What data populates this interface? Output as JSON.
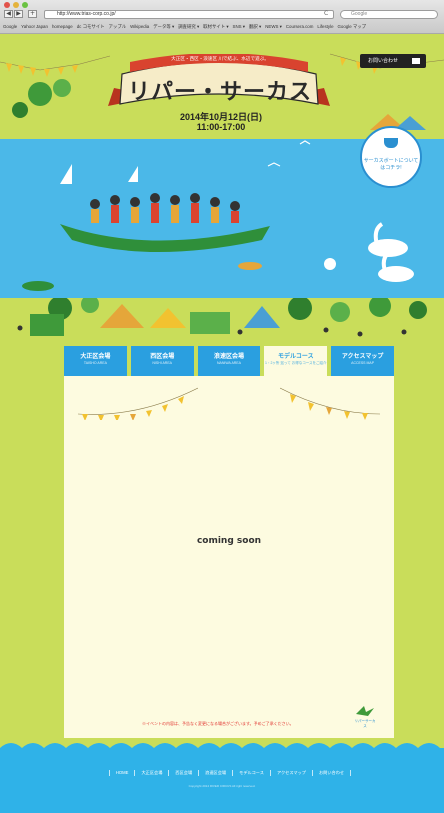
{
  "browser": {
    "url": "http://www.trias-corp.co.jp/",
    "search_placeholder": "Google",
    "bookmarks": [
      "Google",
      "Yahoo! Japan",
      "homepage",
      "dc コモサイト",
      "アップル",
      "Wikipedia",
      "データ等 ▾",
      "調査研究 ▾",
      "取材サイト ▾",
      "SNS ▾",
      "翻訳 ▾",
      "NEWS ▾",
      "Coursera.com",
      "Lifestyle",
      "Google マップ"
    ]
  },
  "hero": {
    "tagline": "大正区・西区・浪速区 川で結ぶ、水辺で遊ぶ。",
    "title": "リパー・サーカス",
    "date": "2014年10月12日(日)",
    "time": "11:00-17:00",
    "contact_label": "お問い合わせ",
    "support_text": "サーカスボートについてはコチラ!"
  },
  "tabs": [
    {
      "label": "大正区会場",
      "sub": "TAISHO AREA"
    },
    {
      "label": "西区会場",
      "sub": "NISHI AREA"
    },
    {
      "label": "浪速区会場",
      "sub": "NANIWA AREA"
    },
    {
      "label": "モデルコース",
      "sub": "1・2ヶ所 巡って お得なコースをご紹介"
    },
    {
      "label": "アクセスマップ",
      "sub": "ACCESS MAP"
    }
  ],
  "content": {
    "coming_soon": "coming soon",
    "note": "※イベントの内容は、予告なく変更になる場合がございます。予めご了承ください。",
    "logo_text": "リパーサーカス"
  },
  "footer": {
    "nav": [
      "HOME",
      "大正区会場",
      "西区会場",
      "浪速区会場",
      "モデルコース",
      "アクセスマップ",
      "お問い合わせ"
    ],
    "copyright": "Copyright 2014 RIVER CIRCUS All right reserved."
  },
  "colors": {
    "grass": "#c9dd5a",
    "water": "#4bb8e8",
    "accent_blue": "#2a9fe0",
    "panel": "#fdfbe0",
    "banner_red": "#d9432f"
  }
}
